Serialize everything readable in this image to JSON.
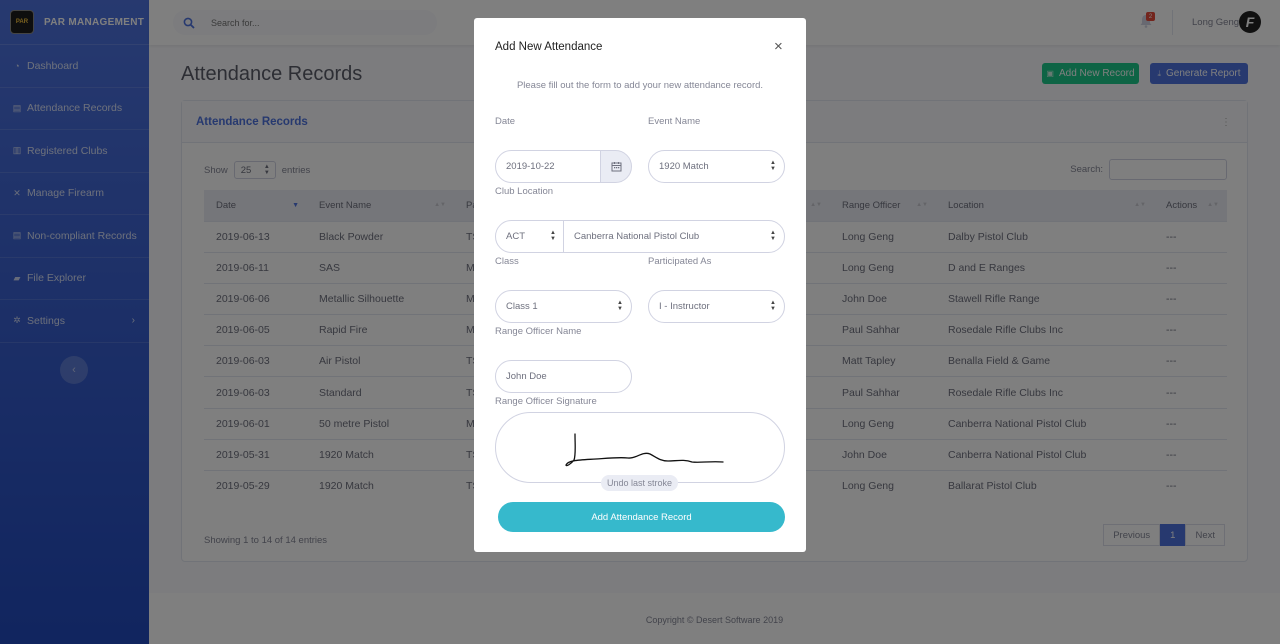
{
  "brand": {
    "name": "PAR MANAGEMENT",
    "logo_text": "PAR"
  },
  "sidebar": {
    "items": [
      {
        "label": "Dashboard",
        "icon": "dashboard-icon"
      },
      {
        "label": "Attendance Records",
        "icon": "trash-icon"
      },
      {
        "label": "Registered Clubs",
        "icon": "building-icon"
      },
      {
        "label": "Manage Firearm",
        "icon": "crosshair-icon"
      },
      {
        "label": "Non-compliant Records",
        "icon": "trash-icon"
      },
      {
        "label": "File Explorer",
        "icon": "folder-icon"
      },
      {
        "label": "Settings",
        "icon": "gear-icon"
      }
    ]
  },
  "topbar": {
    "search_placeholder": "Search for...",
    "notification_count": "2",
    "user_name": "Long Geng",
    "avatar_letter": "F"
  },
  "page": {
    "title": "Attendance Records",
    "add_button": "Add New Record",
    "generate_button": "Generate Report"
  },
  "card": {
    "title": "Attendance Records",
    "show_label": "Show",
    "page_length": "25",
    "entries_label": "entries",
    "search_label": "Search:",
    "columns": [
      "Date",
      "Event Name",
      "Pa",
      "Range Officer",
      "Location",
      "Actions"
    ],
    "rows": [
      {
        "date": "2019-06-13",
        "event": "Black Powder",
        "pa": "TS",
        "officer": "Long Geng",
        "location": "Dalby Pistol Club",
        "actions": "---"
      },
      {
        "date": "2019-06-11",
        "event": "SAS",
        "pa": "M",
        "officer": "Long Geng",
        "location": "D and E Ranges",
        "actions": "---"
      },
      {
        "date": "2019-06-06",
        "event": "Metallic Silhouette",
        "pa": "M",
        "officer": "John Doe",
        "location": "Stawell Rifle Range",
        "actions": "---"
      },
      {
        "date": "2019-06-05",
        "event": "Rapid Fire",
        "pa": "M",
        "officer": "Paul Sahhar",
        "location": "Rosedale Rifle Clubs Inc",
        "actions": "---"
      },
      {
        "date": "2019-06-03",
        "event": "Air Pistol",
        "pa": "TS",
        "officer": "Matt Tapley",
        "location": "Benalla Field & Game",
        "actions": "---"
      },
      {
        "date": "2019-06-03",
        "event": "Standard",
        "pa": "TS",
        "officer": "Paul Sahhar",
        "location": "Rosedale Rifle Clubs Inc",
        "actions": "---"
      },
      {
        "date": "2019-06-01",
        "event": "50 metre Pistol",
        "pa": "M",
        "officer": "Long Geng",
        "location": "Canberra National Pistol Club",
        "actions": "---"
      },
      {
        "date": "2019-05-31",
        "event": "1920 Match",
        "pa": "TS",
        "officer": "John Doe",
        "location": "Canberra National Pistol Club",
        "actions": "---"
      },
      {
        "date": "2019-05-29",
        "event": "1920 Match",
        "pa": "TS",
        "officer": "Long Geng",
        "location": "Ballarat Pistol Club",
        "actions": "---"
      }
    ],
    "showing_text": "Showing 1 to 14 of 14 entries",
    "pager": {
      "previous": "Previous",
      "current": "1",
      "next": "Next"
    }
  },
  "footer": {
    "text": "Copyright © Desert Software 2019"
  },
  "modal": {
    "title": "Add New Attendance",
    "close": "×",
    "subtitle": "Please fill out the form to add your new attendance record.",
    "date_label": "Date",
    "date_value": "2019-10-22",
    "event_label": "Event Name",
    "event_value": "1920 Match",
    "club_label": "Club Location",
    "state_value": "ACT",
    "club_value": "Canberra National Pistol Club",
    "class_label": "Class",
    "class_value": "Class 1",
    "participated_label": "Participated As",
    "participated_value": "I - Instructor",
    "officer_name_label": "Range Officer Name",
    "officer_name_value": "John Doe",
    "signature_label": "Range Officer Signature",
    "undo_label": "Undo last stroke",
    "submit_label": "Add Attendance Record"
  }
}
